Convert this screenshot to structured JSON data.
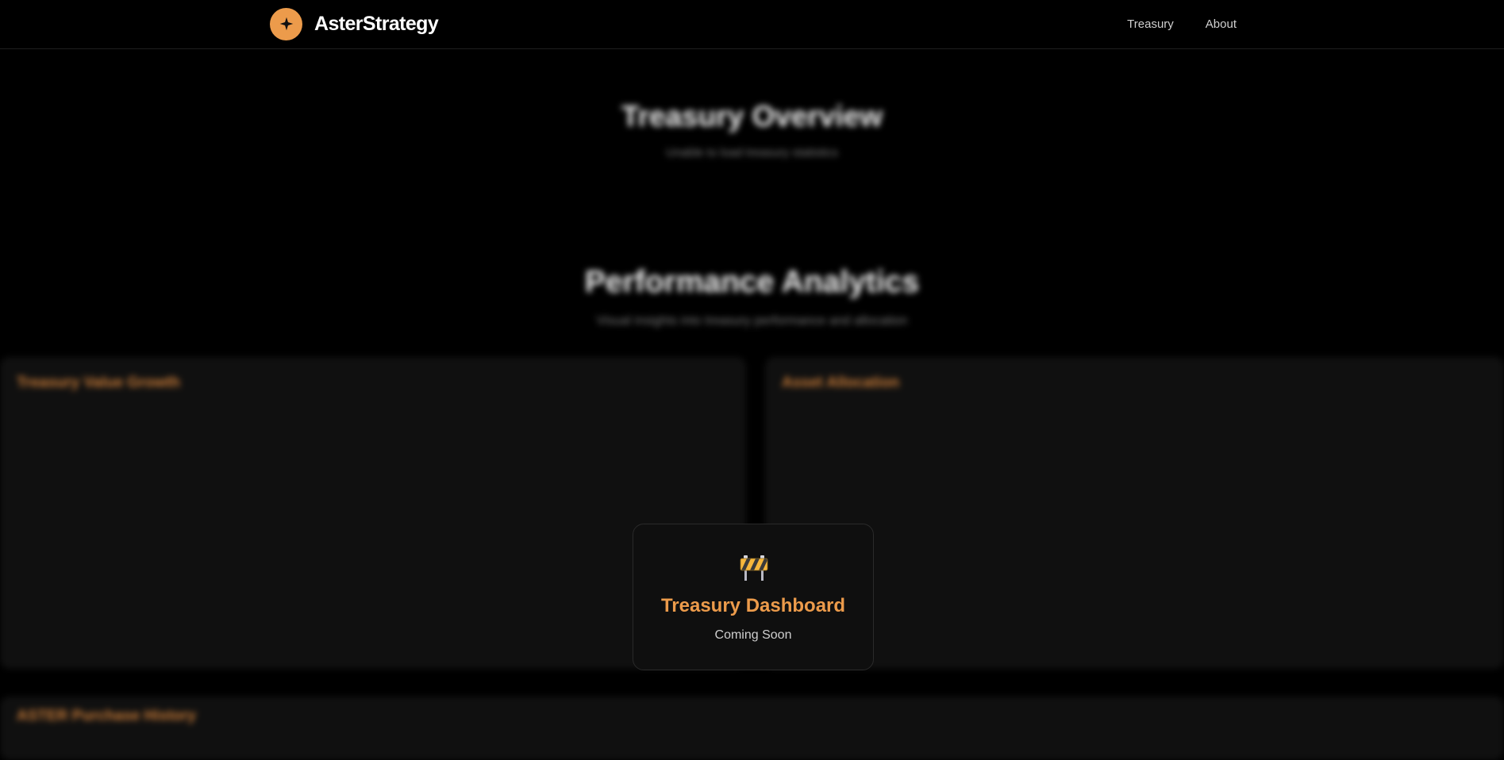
{
  "brand": {
    "name": "AsterStrategy",
    "logo_icon": "sparkle-icon",
    "accent_color": "#ec9b4b"
  },
  "nav": {
    "links": [
      {
        "label": "Treasury"
      },
      {
        "label": "About"
      }
    ]
  },
  "treasury_section": {
    "title": "Treasury Overview",
    "subtitle": "Unable to load treasury statistics"
  },
  "performance_section": {
    "title": "Performance Analytics",
    "subtitle": "Visual insights into treasury performance and allocation"
  },
  "charts": [
    {
      "title": "Treasury Value Growth"
    },
    {
      "title": "Asset Allocation"
    }
  ],
  "bottom_card": {
    "title": "ASTER Purchase History"
  },
  "overlay": {
    "icon": "construction-barrier-icon",
    "title": "Treasury Dashboard",
    "subtitle": "Coming Soon"
  }
}
